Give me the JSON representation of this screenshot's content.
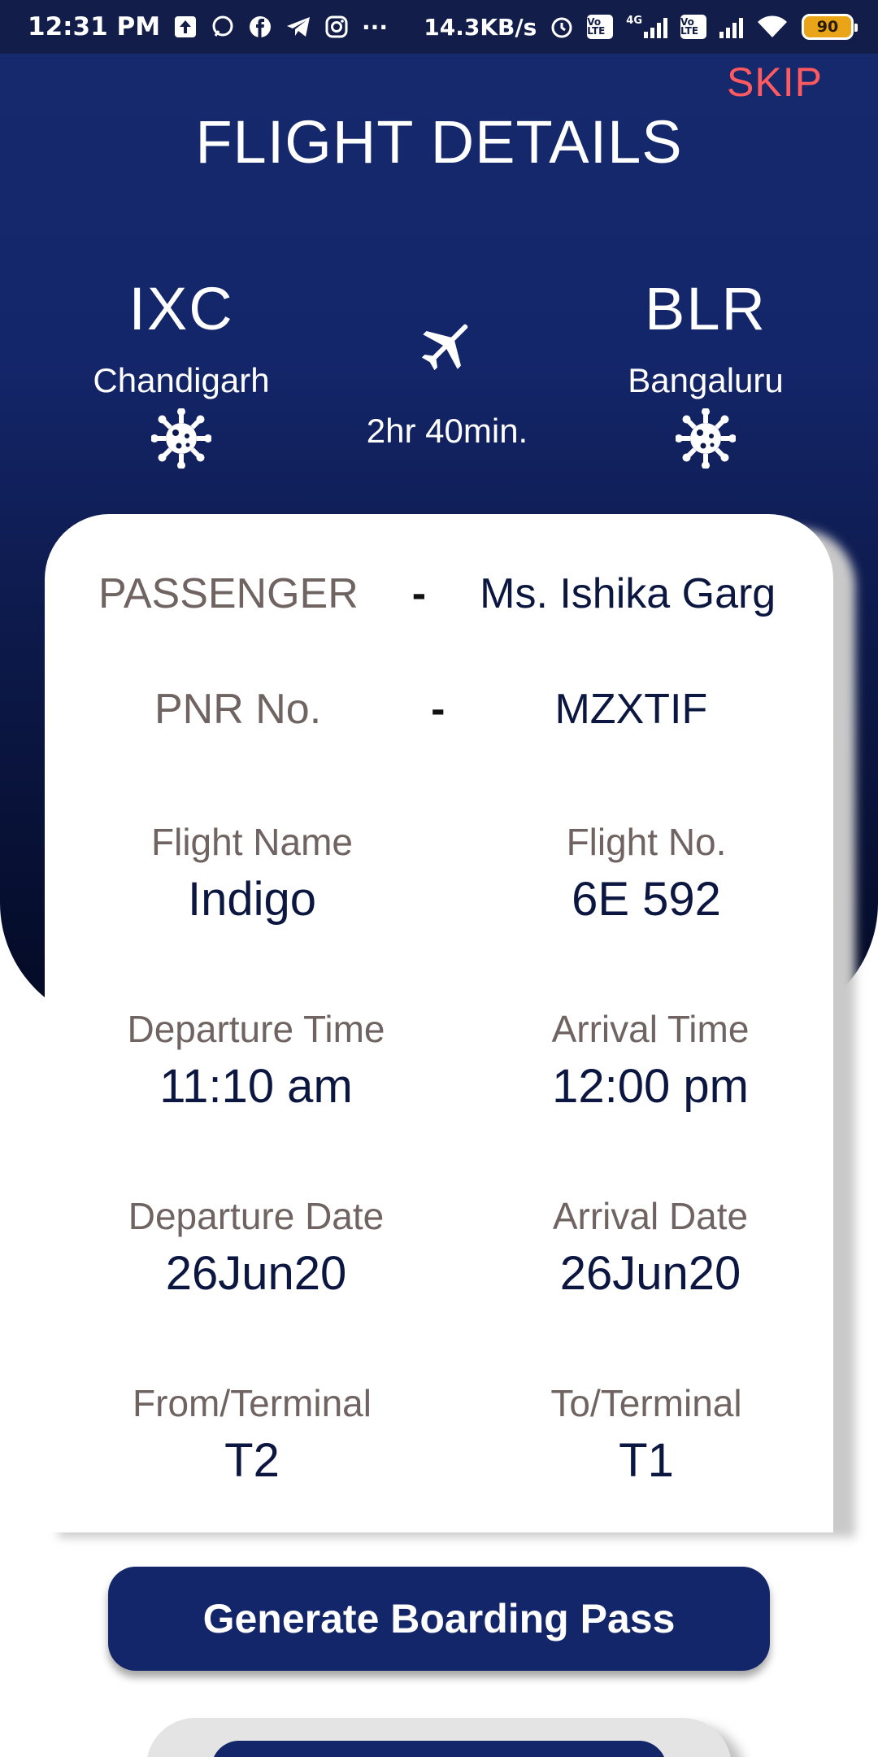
{
  "status_bar": {
    "time": "12:31 PM",
    "more": "···",
    "net_speed": "14.3KB/s",
    "volte": "Vo LTE",
    "network": "4G",
    "battery": "90"
  },
  "header": {
    "skip_label": "SKIP",
    "title": "FLIGHT DETAILS"
  },
  "route": {
    "from": {
      "code": "IXC",
      "city": "Chandigarh"
    },
    "to": {
      "code": "BLR",
      "city": "Bangaluru"
    },
    "duration": "2hr 40min."
  },
  "details": {
    "passenger_label": "PASSENGER",
    "passenger_sep": "-",
    "passenger_value": "Ms. Ishika Garg",
    "pnr_label": "PNR No.",
    "pnr_sep": "-",
    "pnr_value": "MZXTIF",
    "fields": [
      {
        "label": "Flight Name",
        "value": "Indigo"
      },
      {
        "label": "Flight No.",
        "value": "6E 592"
      },
      {
        "label": "Departure Time",
        "value": "11:10 am"
      },
      {
        "label": "Arrival Time",
        "value": "12:00 pm"
      },
      {
        "label": "Departure Date",
        "value": "26Jun20"
      },
      {
        "label": "Arrival Date",
        "value": "26Jun20"
      },
      {
        "label": "From/Terminal",
        "value": "T2"
      },
      {
        "label": "To/Terminal",
        "value": "T1"
      }
    ]
  },
  "actions": {
    "generate_label": "Generate Boarding Pass"
  }
}
